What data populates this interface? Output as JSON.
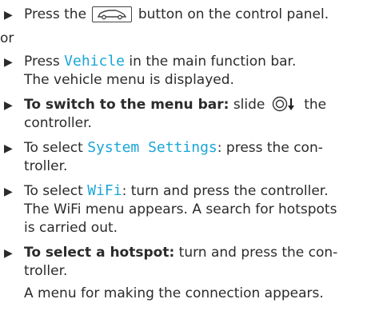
{
  "steps": [
    {
      "bullet": "▶",
      "before": "Press the",
      "icon": "car-icon",
      "after": "button on the control panel."
    },
    {
      "text": "or"
    },
    {
      "bullet": "▶",
      "before": "Press",
      "mono": "Vehicle",
      "after": "in the main function bar.",
      "line2": "The vehicle menu is displayed."
    },
    {
      "bullet": "▶",
      "bold": "To switch to the menu bar:",
      "before": "slide",
      "icon": "controller-slide-down-icon",
      "after": "the",
      "line2": "controller."
    },
    {
      "bullet": "▶",
      "before": "To select",
      "mono": "System Settings",
      "after": ": press the con-",
      "line2": "troller."
    },
    {
      "bullet": "▶",
      "before": "To select",
      "mono": "WiFi",
      "after": ": turn and press the controller.",
      "line2": "The WiFi menu appears. A search for hotspots",
      "line3": "is carried out."
    },
    {
      "bullet": "▶",
      "bold": "To select a hotspot:",
      "after": "turn and press the con-",
      "line2": "troller.",
      "line3": "A menu for making the connection appears."
    }
  ]
}
